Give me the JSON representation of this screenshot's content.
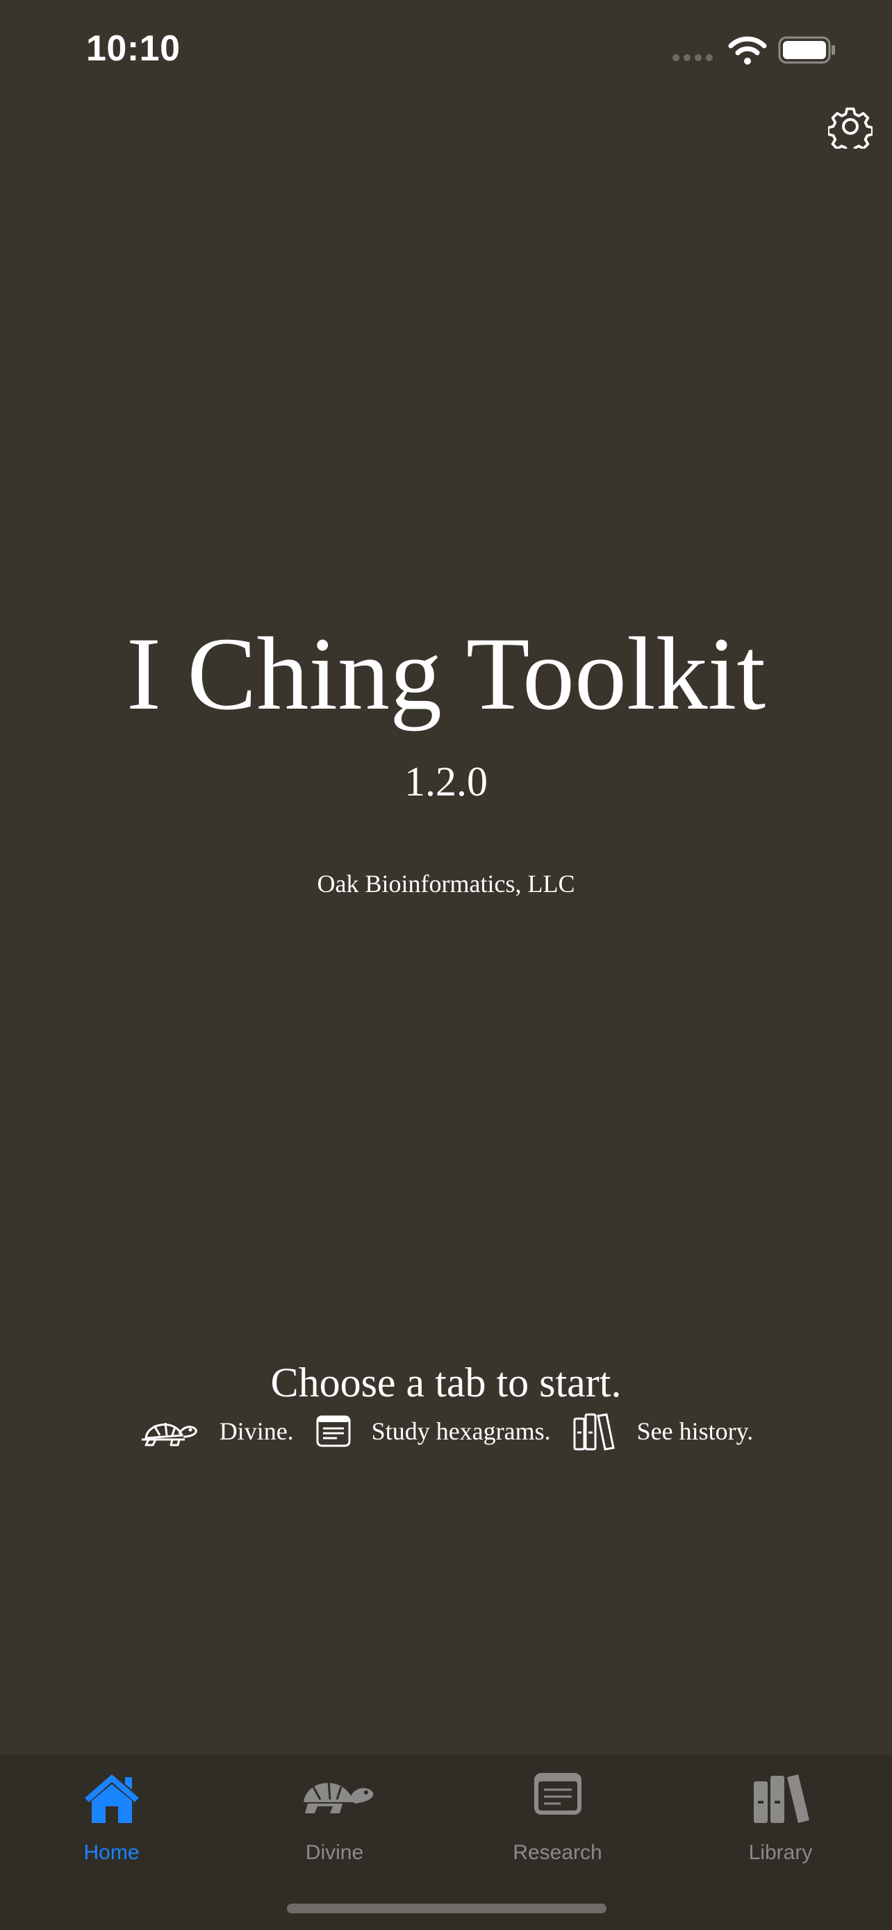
{
  "status_bar": {
    "time": "10:10"
  },
  "app": {
    "title": "I Ching Toolkit",
    "version": "1.2.0",
    "company": "Oak Bioinformatics, LLC"
  },
  "main": {
    "prompt": "Choose a tab to start.",
    "hints": [
      {
        "icon": "turtle-icon",
        "label": "Divine."
      },
      {
        "icon": "document-icon",
        "label": "Study hexagrams."
      },
      {
        "icon": "books-icon",
        "label": "See history."
      }
    ]
  },
  "tabbar": {
    "tabs": [
      {
        "label": "Home",
        "icon": "house-icon",
        "active": true
      },
      {
        "label": "Divine",
        "icon": "turtle-icon",
        "active": false
      },
      {
        "label": "Research",
        "icon": "document-icon",
        "active": false
      },
      {
        "label": "Library",
        "icon": "books-icon",
        "active": false
      }
    ]
  },
  "colors": {
    "background": "#39352d",
    "tabbar": "#302d27",
    "accent": "#1a84ff",
    "inactive": "#8b8a88"
  }
}
